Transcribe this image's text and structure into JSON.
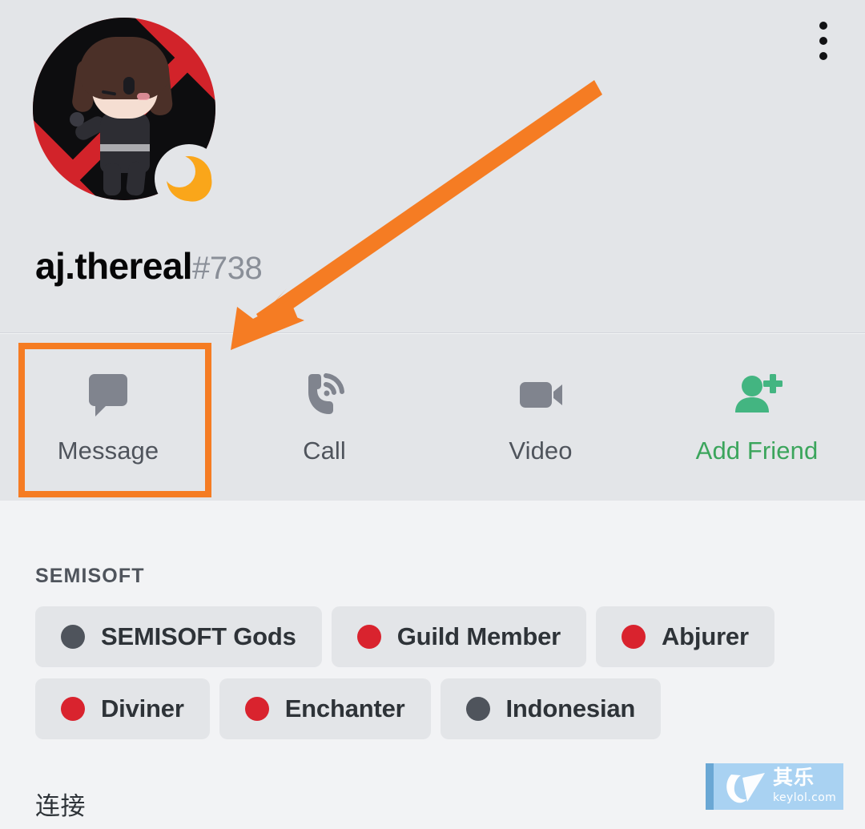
{
  "header": {
    "username": "aj.thereal",
    "discriminator": "#738",
    "status": "idle",
    "status_icon": "crescent-moon-icon",
    "avatar_alt": "chibi-character-avatar",
    "overflow_menu_icon": "more-vertical-icon"
  },
  "actions": [
    {
      "label": "Message",
      "icon": "chat-bubble-icon",
      "accent": false,
      "highlighted": true
    },
    {
      "label": "Call",
      "icon": "phone-call-icon",
      "accent": false,
      "highlighted": false
    },
    {
      "label": "Video",
      "icon": "video-camera-icon",
      "accent": false,
      "highlighted": false
    },
    {
      "label": "Add Friend",
      "icon": "person-add-icon",
      "accent": true,
      "highlighted": false
    }
  ],
  "roles_section": {
    "title": "SEMISOFT",
    "roles": [
      {
        "name": "SEMISOFT Gods",
        "color": "#4f545c"
      },
      {
        "name": "Guild Member",
        "color": "#d9232e"
      },
      {
        "name": "Abjurer",
        "color": "#d9232e"
      },
      {
        "name": "Diviner",
        "color": "#d9232e"
      },
      {
        "name": "Enchanter",
        "color": "#d9232e"
      },
      {
        "name": "Indonesian",
        "color": "#4f545c"
      }
    ]
  },
  "connections_section": {
    "title": "连接"
  },
  "annotation": {
    "arrow_color": "#f57c23",
    "highlight_color": "#f57c23",
    "points_to": "Message"
  },
  "watermark": {
    "cn_text": "其乐",
    "url_text": "keylol.com",
    "background": "#a9d2f2"
  },
  "colors": {
    "header_bg": "#e3e5e8",
    "body_bg": "#f2f3f5",
    "accent_green": "#3ba55c",
    "idle_orange": "#faa61a",
    "role_red": "#d9232e",
    "role_slate": "#4f545c"
  }
}
